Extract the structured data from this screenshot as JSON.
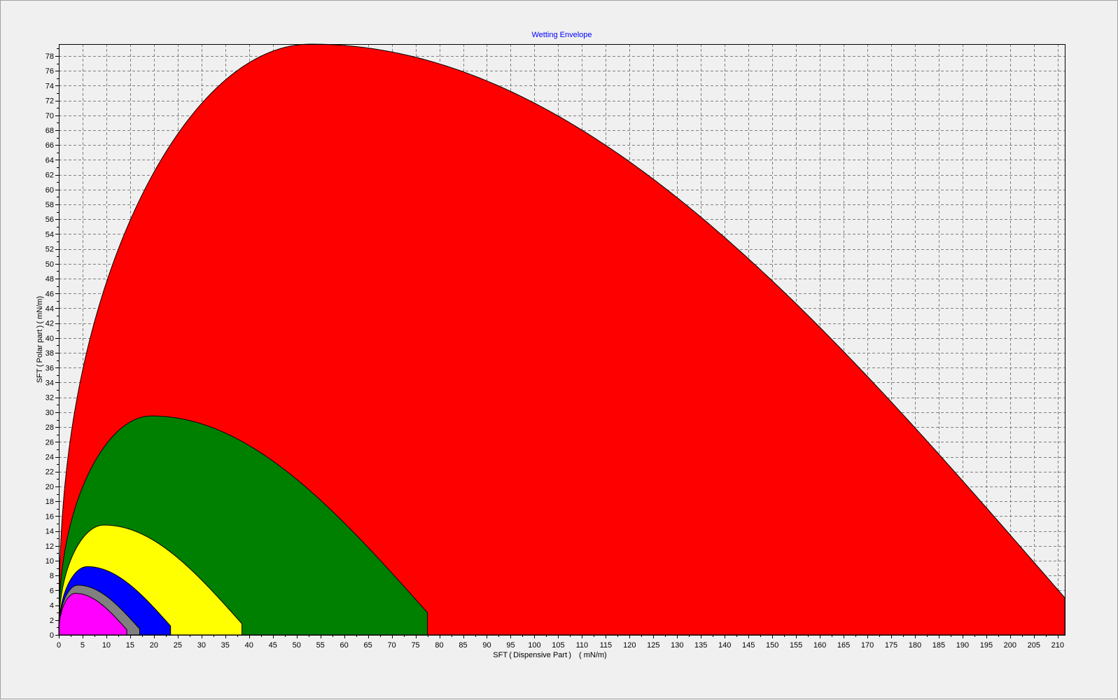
{
  "chart_data": {
    "type": "area",
    "title": "Wetting Envelope",
    "xlabel": "SFT ( Dispensive Part ) ( mN/m)",
    "ylabel": "SFT ( Polar part ) ( mN/m)",
    "xlim": [
      0,
      211.5
    ],
    "ylim": [
      0,
      79.6
    ],
    "x_ticks": [
      0,
      5,
      10,
      15,
      20,
      25,
      30,
      35,
      40,
      45,
      50,
      55,
      60,
      65,
      70,
      75,
      80,
      85,
      90,
      95,
      100,
      105,
      110,
      115,
      120,
      125,
      130,
      135,
      140,
      145,
      150,
      155,
      160,
      165,
      170,
      175,
      180,
      185,
      190,
      195,
      200,
      205,
      210
    ],
    "y_ticks": [
      0,
      2,
      4,
      6,
      8,
      10,
      12,
      14,
      16,
      18,
      20,
      22,
      24,
      26,
      28,
      30,
      32,
      34,
      36,
      38,
      40,
      42,
      44,
      46,
      48,
      50,
      52,
      54,
      56,
      58,
      60,
      62,
      64,
      66,
      68,
      70,
      72,
      74,
      76,
      78
    ],
    "x_minor_step": 2.5,
    "grid": true,
    "grid_style": "dashed",
    "series": [
      {
        "color": "#ff0000",
        "peak_x": 53.0,
        "peak_y": 79.6,
        "x_end": 211.5,
        "y_at_end": 5.0
      },
      {
        "color": "#008000",
        "peak_x": 19.5,
        "peak_y": 29.5,
        "x_end": 77.5,
        "y_at_end": 3.0
      },
      {
        "color": "#ffff00",
        "peak_x": 9.5,
        "peak_y": 14.8,
        "x_end": 38.5,
        "y_at_end": 1.5
      },
      {
        "color": "#0000ff",
        "peak_x": 6.0,
        "peak_y": 9.2,
        "x_end": 23.5,
        "y_at_end": 1.2
      },
      {
        "color": "#808080",
        "peak_x": 4.0,
        "peak_y": 6.7,
        "x_end": 17.0,
        "y_at_end": 0.8
      },
      {
        "color": "#ff00ff",
        "peak_x": 3.5,
        "peak_y": 5.6,
        "x_end": 14.3,
        "y_at_end": 0.7
      }
    ]
  }
}
